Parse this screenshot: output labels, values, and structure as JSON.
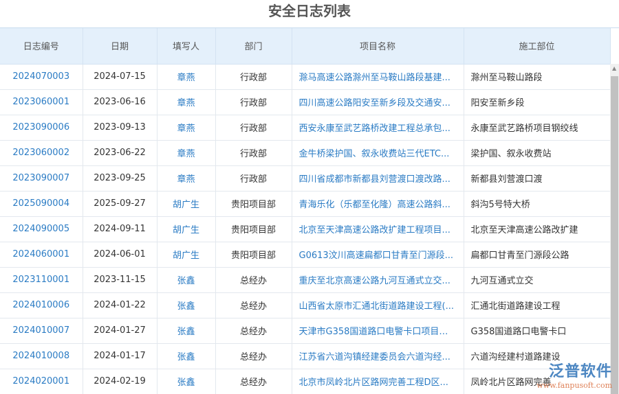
{
  "title": "安全日志列表",
  "columns": [
    "日志编号",
    "日期",
    "填写人",
    "部门",
    "项目名称",
    "施工部位"
  ],
  "rows": [
    [
      "2024070003",
      "2024-07-15",
      "章燕",
      "行政部",
      "滁马高速公路滁州至马鞍山路段基建...",
      "滁州至马鞍山路段"
    ],
    [
      "2023060001",
      "2023-06-16",
      "章燕",
      "行政部",
      "四川高速公路阳安至新乡段及交通安...",
      "阳安至新乡段"
    ],
    [
      "2023090006",
      "2023-09-13",
      "章燕",
      "行政部",
      "西安永康至武艺路桥改建工程总承包...",
      "永康至武艺路桥项目钢绞线"
    ],
    [
      "2023060002",
      "2023-06-22",
      "章燕",
      "行政部",
      "金牛桥梁护国、叙永收费站三代ETC...",
      "梁护国、叙永收费站"
    ],
    [
      "2023090007",
      "2023-09-25",
      "章燕",
      "行政部",
      "四川省成都市新都县刘营渡口渡改路...",
      "新都县刘营渡口渡"
    ],
    [
      "2025090004",
      "2025-09-27",
      "胡广生",
      "贵阳项目部",
      "青海乐化（乐都至化隆）高速公路斜...",
      "斜沟5号特大桥"
    ],
    [
      "2024090005",
      "2024-09-11",
      "胡广生",
      "贵阳项目部",
      "北京至天津高速公路改扩建工程项目...",
      "北京至天津高速公路改扩建"
    ],
    [
      "2024060001",
      "2024-06-01",
      "胡广生",
      "贵阳项目部",
      "G0613汶川高速扁都口甘青至门源段...",
      "扁都口甘青至门源段公路"
    ],
    [
      "2023110001",
      "2023-11-15",
      "张鑫",
      "总经办",
      "重庆至北京高速公路九河互通式立交...",
      "九河互通式立交"
    ],
    [
      "2024010006",
      "2024-01-22",
      "张鑫",
      "总经办",
      "山西省太原市汇通北街道路建设工程(...",
      "汇通北街道路建设工程"
    ],
    [
      "2024010007",
      "2024-01-27",
      "张鑫",
      "总经办",
      "天津市G358国道路口电警卡口项目设...",
      "G358国道路口电警卡口"
    ],
    [
      "2024010008",
      "2024-01-17",
      "张鑫",
      "总经办",
      "江苏省六道沟镇经建委员会六道沟经...",
      "六道沟经建村道路建设"
    ],
    [
      "2024020001",
      "2024-02-19",
      "张鑫",
      "总经办",
      "北京市凤岭北片区路网完善工程D区...",
      "凤岭北片区路网完善"
    ]
  ],
  "watermark": {
    "name": "泛普软件",
    "url": "www.fanpusoft.com"
  }
}
